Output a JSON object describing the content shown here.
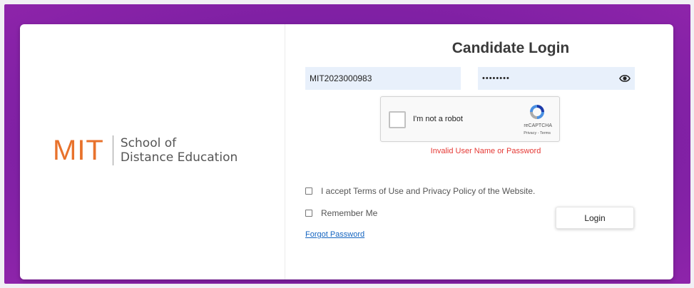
{
  "brand": {
    "mark": "MIT",
    "line1": "School of",
    "line2": "Distance Education",
    "mark_color": "#e8722c"
  },
  "form": {
    "title": "Candidate Login",
    "username_value": "MIT2023000983",
    "password_masked": "••••••••",
    "eye_icon": "eye-icon",
    "captcha": {
      "label": "I'm not a robot",
      "brand": "reCAPTCHA",
      "links": "Privacy - Terms"
    },
    "error_text": "Invalid User Name or Password",
    "error_color": "#e53935",
    "terms_label": "I accept Terms of Use and Privacy Policy of the Website.",
    "remember_label": "Remember Me",
    "forgot_label": "Forgot Password",
    "login_label": "Login"
  },
  "colors": {
    "frame_purple": "#7b1fa2",
    "field_bg": "#e8f0fb",
    "link": "#1565c0"
  }
}
